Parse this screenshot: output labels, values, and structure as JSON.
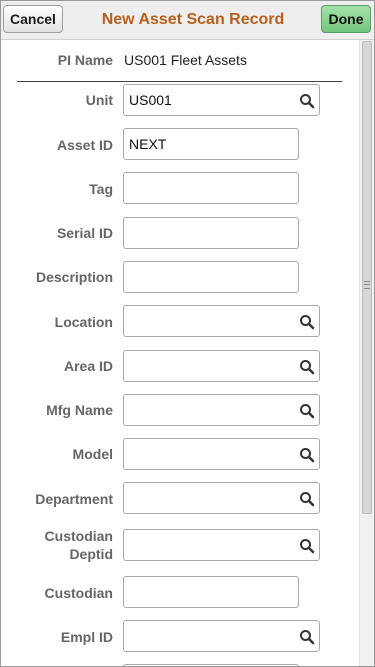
{
  "header": {
    "cancel_label": "Cancel",
    "title": "New Asset Scan Record",
    "done_label": "Done"
  },
  "pi": {
    "label": "PI Name",
    "value": "US001 Fleet Assets"
  },
  "fields": [
    {
      "label": "Unit",
      "value": "US001",
      "lookup": true
    },
    {
      "label": "Asset ID",
      "value": "NEXT",
      "lookup": false
    },
    {
      "label": "Tag",
      "value": "",
      "lookup": false
    },
    {
      "label": "Serial ID",
      "value": "",
      "lookup": false
    },
    {
      "label": "Description",
      "value": "",
      "lookup": false
    },
    {
      "label": "Location",
      "value": "",
      "lookup": true
    },
    {
      "label": "Area ID",
      "value": "",
      "lookup": true
    },
    {
      "label": "Mfg Name",
      "value": "",
      "lookup": true
    },
    {
      "label": "Model",
      "value": "",
      "lookup": true
    },
    {
      "label": "Department",
      "value": "",
      "lookup": true
    },
    {
      "label_line1": "Custodian",
      "label_line2": "Deptid",
      "value": "",
      "lookup": true
    },
    {
      "label": "Custodian",
      "value": "",
      "lookup": false
    },
    {
      "label": "Empl ID",
      "value": "",
      "lookup": true
    }
  ],
  "colors": {
    "title": "#b85f1c",
    "label": "#666666",
    "done_button": "#74c57d"
  },
  "icons": {
    "lookup": "search-icon"
  }
}
